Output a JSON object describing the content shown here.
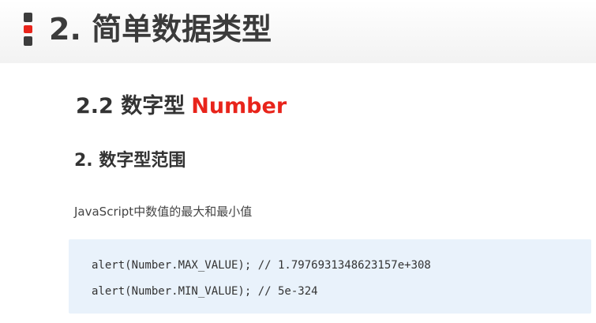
{
  "header": {
    "title": "2. 简单数据类型"
  },
  "section": {
    "title_prefix": "2.2 数字型",
    "title_highlight": "Number",
    "subheading": "2. 数字型范围",
    "description": "JavaScript中数值的最大和最小值"
  },
  "code": {
    "lines": [
      "alert(Number.MAX_VALUE); // 1.7976931348623157e+308",
      "alert(Number.MIN_VALUE); // 5e-324"
    ]
  },
  "colors": {
    "accent": "#e8241b",
    "code_background": "#e9f2fb",
    "marker_dark": "#3d3d3d"
  }
}
